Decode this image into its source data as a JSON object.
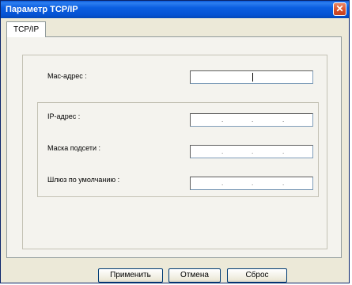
{
  "window": {
    "title": "Параметр TCP/IP",
    "close_glyph": "✕"
  },
  "tabs": [
    {
      "label": "TCP/IP",
      "active": true
    }
  ],
  "fields": {
    "mac": {
      "label": "Mac-адрес :",
      "value": ""
    },
    "ip": {
      "label": "IP-адрес :",
      "value": " .  .  . "
    },
    "mask": {
      "label": "Маска подсети :",
      "value": " .  .  . "
    },
    "gateway": {
      "label": "Шлюз по умолчанию :",
      "value": " .  .  . "
    }
  },
  "buttons": {
    "apply": "Применить",
    "cancel": "Отмена",
    "reset": "Сброс"
  },
  "colors": {
    "title_bar": "#0553d4",
    "close_button": "#d8502a",
    "dialog_bg": "#ece9d8"
  }
}
